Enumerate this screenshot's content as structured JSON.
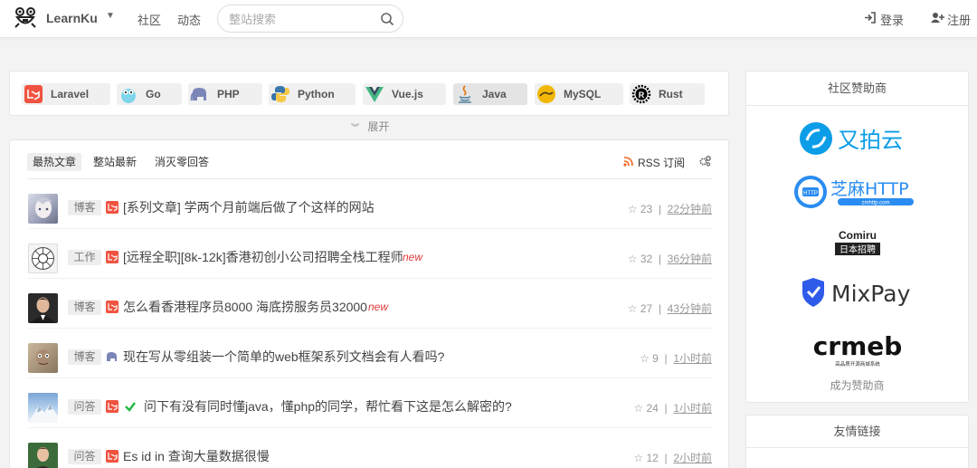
{
  "header": {
    "brand": "LearnKu",
    "nav": [
      "社区",
      "动态"
    ],
    "search_placeholder": "整站搜索",
    "login": "登录",
    "register": "注册"
  },
  "categories": [
    {
      "label": "Laravel",
      "icon": "laravel-icon",
      "color": "#f05340"
    },
    {
      "label": "Go",
      "icon": "go-gopher-icon",
      "color": "#7fd5ea"
    },
    {
      "label": "PHP",
      "icon": "php-elephant-icon",
      "color": "#7a86b8"
    },
    {
      "label": "Python",
      "icon": "python-icon",
      "color": "#3776ab"
    },
    {
      "label": "Vue.js",
      "icon": "vue-icon",
      "color": "#42b883"
    },
    {
      "label": "Java",
      "icon": "java-icon",
      "color": "#e76f00"
    },
    {
      "label": "MySQL",
      "icon": "mysql-icon",
      "color": "#f2b705"
    },
    {
      "label": "Rust",
      "icon": "rust-icon",
      "color": "#000000"
    }
  ],
  "expand_label": "展开",
  "tabs": [
    "最热文章",
    "整站最新",
    "消灭零回答"
  ],
  "rss_label": "RSS 订阅",
  "posts": [
    {
      "badge": "博客",
      "title": "[系列文章] 学两个月前端后做了个这样的网站",
      "new": false,
      "likes": "23",
      "time": "22分钟前",
      "icon": "laravel-icon"
    },
    {
      "badge": "工作",
      "title": "[远程全职][8k-12k]香港初创小公司招聘全栈工程师",
      "new": true,
      "likes": "32",
      "time": "36分钟前",
      "icon": "laravel-icon"
    },
    {
      "badge": "博客",
      "title": "怎么看香港程序员8000 海底捞服务员32000",
      "new": true,
      "likes": "27",
      "time": "43分钟前",
      "icon": "laravel-icon"
    },
    {
      "badge": "博客",
      "title": "现在写从零组装一个简单的web框架系列文档会有人看吗?",
      "new": false,
      "likes": "9",
      "time": "1小时前",
      "icon": "php-elephant-icon"
    },
    {
      "badge": "问答",
      "title": "问下有没有同时懂java，懂php的同学，帮忙看下这是怎么解密的?",
      "new": false,
      "likes": "24",
      "time": "1小时前",
      "icon": "laravel-icon",
      "solved": true
    },
    {
      "badge": "问答",
      "title": "Es id in 查询大量数据很慢",
      "new": false,
      "likes": "12",
      "time": "2小时前",
      "icon": "laravel-icon"
    }
  ],
  "new_label": "new",
  "sidebar": {
    "sponsor_title": "社区赞助商",
    "sponsors": [
      "又拍云",
      "芝麻HTTP",
      "Comiru",
      "日本招聘",
      "MixPay",
      "crmeb"
    ],
    "zhima_sub": "zmhttp.com",
    "crmeb_sub": "高品质开源商城系统",
    "become_sponsor": "成为赞助商",
    "friends_title": "友情链接"
  }
}
